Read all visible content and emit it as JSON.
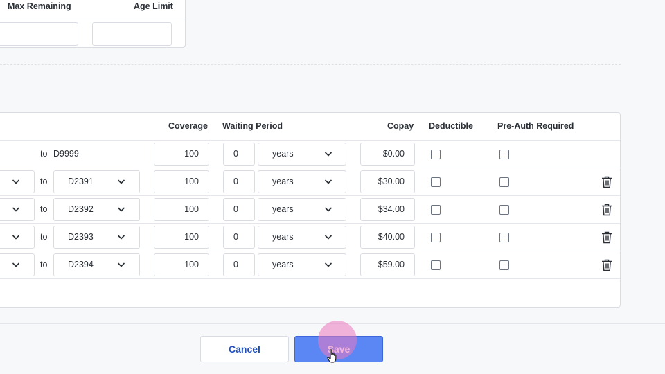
{
  "limits": {
    "max_remaining_label": "Max Remaining",
    "age_limit_label": "Age Limit",
    "max_remaining_value": "",
    "age_limit_value": ""
  },
  "table": {
    "headers": {
      "coverage": "Coverage",
      "waiting_period": "Waiting Period",
      "copay": "Copay",
      "deductible": "Deductible",
      "pre_auth": "Pre-Auth Required"
    },
    "to_label": "to",
    "rows": [
      {
        "to_code": "D9999",
        "coverage": "100",
        "waiting": "0",
        "unit": "years",
        "copay": "$0.00",
        "deductible": false,
        "pre_auth": false
      },
      {
        "to_code": "D2391",
        "coverage": "100",
        "waiting": "0",
        "unit": "years",
        "copay": "$30.00",
        "deductible": false,
        "pre_auth": false
      },
      {
        "to_code": "D2392",
        "coverage": "100",
        "waiting": "0",
        "unit": "years",
        "copay": "$34.00",
        "deductible": false,
        "pre_auth": false
      },
      {
        "to_code": "D2393",
        "coverage": "100",
        "waiting": "0",
        "unit": "years",
        "copay": "$40.00",
        "deductible": false,
        "pre_auth": false
      },
      {
        "to_code": "D2394",
        "coverage": "100",
        "waiting": "0",
        "unit": "years",
        "copay": "$59.00",
        "deductible": false,
        "pre_auth": false
      }
    ]
  },
  "footer": {
    "cancel_label": "Cancel",
    "save_label": "Save"
  },
  "icons": {
    "chevron": "chevron-down-icon",
    "delete": "trash-icon",
    "cursor": "hand-pointer-icon"
  },
  "colors": {
    "primary": "#5b87f5",
    "link_text": "#1f4fbf",
    "click_highlight": "#ec78be"
  }
}
